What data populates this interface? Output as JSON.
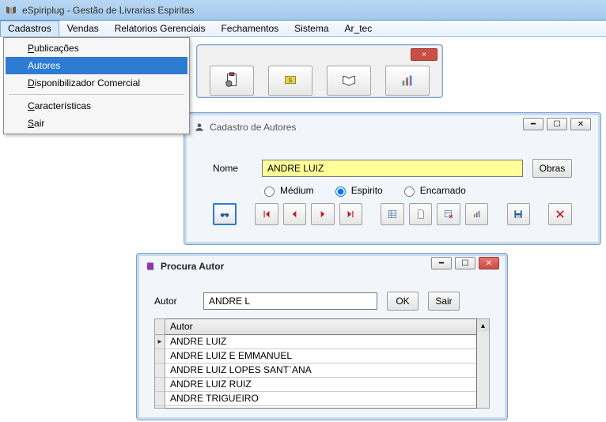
{
  "app": {
    "title": "eSpiriplug - Gestão de Livrarias Espiritas"
  },
  "menubar": [
    "Cadastros",
    "Vendas",
    "Relatorios Gerenciais",
    "Fechamentos",
    "Sistema",
    "Ar_tec"
  ],
  "cadastros_menu": {
    "publicacoes": "Publicações",
    "autores": "Autores",
    "disponibilizador": "Disponibilizador Comercial",
    "caracteristicas": "Características",
    "sair": "Sair"
  },
  "toolbar": {
    "close": "×"
  },
  "author_form": {
    "window_title": "Cadastro de Autores",
    "nome_label": "Nome",
    "nome_value": "ANDRE LUIZ",
    "obras_btn": "Obras",
    "radio": {
      "medium": "Médium",
      "espirito": "Espirito",
      "encarnado": "Encarnado",
      "selected": "espirito"
    }
  },
  "search_form": {
    "window_title": "Procura Autor",
    "autor_label": "Autor",
    "autor_value": "ANDRE L",
    "ok_btn": "OK",
    "sair_btn": "Sair",
    "table_header": "Autor",
    "rows": [
      "ANDRE LUIZ",
      "ANDRE LUIZ E EMMANUEL",
      "ANDRE LUIZ LOPES SANT`ANA",
      "ANDRE LUIZ RUIZ",
      "ANDRE TRIGUEIRO"
    ]
  },
  "sysbtn": {
    "min": "━",
    "max": "☐",
    "close": "✕"
  }
}
